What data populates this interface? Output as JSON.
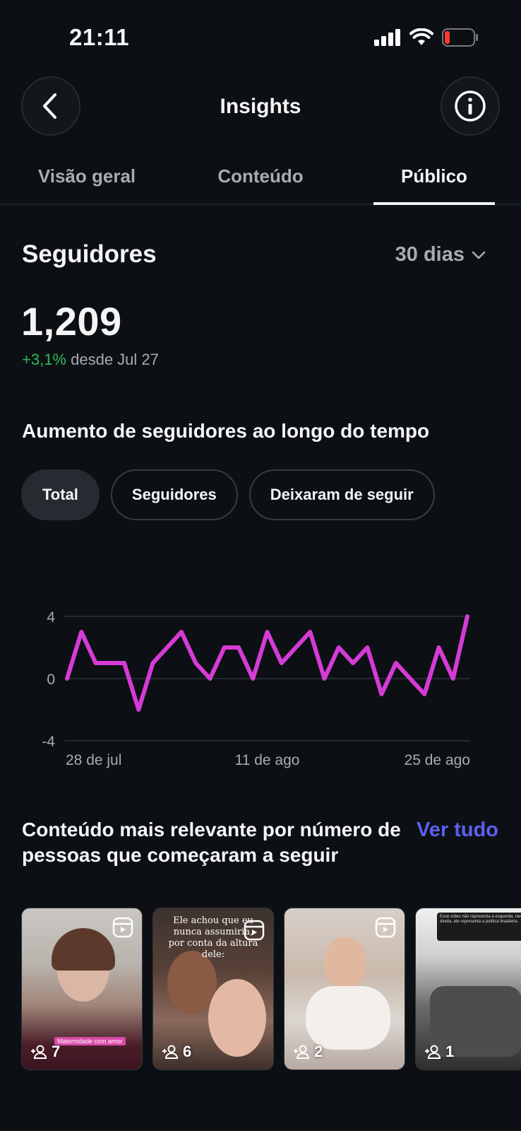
{
  "status_bar": {
    "time": "21:11"
  },
  "header": {
    "title": "Insights"
  },
  "tabs": [
    {
      "label": "Visão geral",
      "active": false
    },
    {
      "label": "Conteúdo",
      "active": false
    },
    {
      "label": "Público",
      "active": true
    }
  ],
  "followers": {
    "title": "Seguidores",
    "period": "30 dias",
    "count": "1,209",
    "change": "+3,1%",
    "since": "desde Jul 27"
  },
  "growth_chart": {
    "heading": "Aumento de seguidores ao longo do tempo",
    "filters": [
      {
        "label": "Total",
        "active": true
      },
      {
        "label": "Seguidores",
        "active": false
      },
      {
        "label": "Deixaram de seguir",
        "active": false
      }
    ]
  },
  "chart_data": {
    "type": "line",
    "title": "",
    "xlabel": "",
    "ylabel": "",
    "ylim": [
      -4,
      4
    ],
    "y_ticks": [
      "4",
      "0",
      "-4"
    ],
    "x_tick_labels": [
      "28 de jul",
      "11 de ago",
      "25 de ago"
    ],
    "grid": true,
    "series": [
      {
        "color": "#d63bd6",
        "values": [
          0,
          3,
          1,
          1,
          1,
          -2,
          1,
          2,
          3,
          1,
          0,
          2,
          2,
          0,
          3,
          1,
          2,
          3,
          0,
          2,
          1,
          2,
          -1,
          1,
          0,
          -1,
          2,
          0,
          4
        ]
      }
    ]
  },
  "top_content": {
    "heading": "Conteúdo mais relevante por número de pessoas que começaram a seguir",
    "see_all": "Ver tudo",
    "items": [
      {
        "count": "7",
        "tag": "Maternidade com amor"
      },
      {
        "count": "6",
        "caption": "Ele achou que eu nunca assumiria, por conta da altura dele:"
      },
      {
        "count": "2"
      },
      {
        "count": "1",
        "comment": "Esse vídeo não representa a esquerda, nem a direita, ele representa a política brasileira."
      }
    ]
  }
}
